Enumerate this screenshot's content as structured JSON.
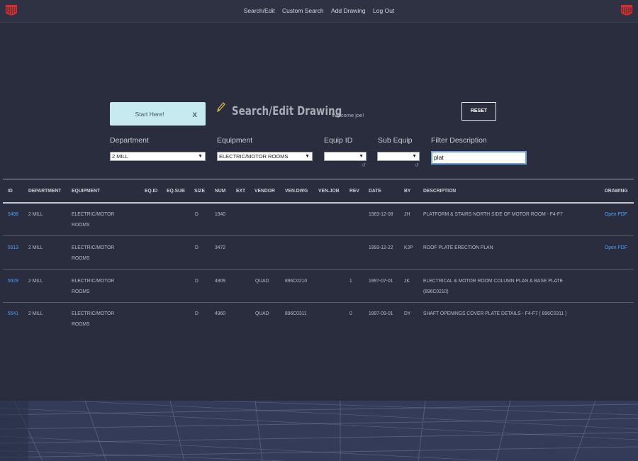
{
  "nav": {
    "items": [
      "Search/Edit",
      "Custom Search",
      "Add Drawing",
      "Log Out"
    ]
  },
  "colors": {
    "brand": "#e02b2b",
    "link": "#4aa1ff",
    "hint_bg": "#c7eaf0"
  },
  "hint": {
    "label": "Start Here!",
    "close": "x"
  },
  "page": {
    "title": "Search/Edit Drawing",
    "welcome": "Welcome joe!",
    "reset_label": "RESET"
  },
  "filters": {
    "department": {
      "label": "Department",
      "value": "2 MILL"
    },
    "equipment": {
      "label": "Equipment",
      "value": "ELECTRIC/MOTOR ROOMS"
    },
    "equip_id": {
      "label": "Equip ID",
      "value": ""
    },
    "sub_equip": {
      "label": "Sub Equip",
      "value": ""
    },
    "description": {
      "label": "Filter Description",
      "value": "plat"
    }
  },
  "table": {
    "headers": [
      "ID",
      "DEPARTMENT",
      "EQUIPMENT",
      "EQ.ID",
      "EQ.SUB",
      "SIZE",
      "NUM",
      "EXT",
      "VENDOR",
      "VEN.DWG",
      "VEN.JOB",
      "REV",
      "DATE",
      "BY",
      "DESCRIPTION",
      "DRAWING"
    ],
    "rows": [
      {
        "id": "5498",
        "department": "2 MILL",
        "equipment": "ELECTRIC/MOTOR ROOMS",
        "size": "D",
        "num": "1940",
        "vendor": "",
        "ven_dwg": "",
        "rev": "",
        "date": "1983-12-08",
        "by": "JH",
        "description": "PLATFORM & STAIRS NORTH SIDE OF MOTOR ROOM - F4-F7",
        "drawing": "Open PDF"
      },
      {
        "id": "5513",
        "department": "2 MILL",
        "equipment": "ELECTRIC/MOTOR ROOMS",
        "size": "D",
        "num": "3472",
        "vendor": "",
        "ven_dwg": "",
        "rev": "",
        "date": "1993-12-22",
        "by": "KJP",
        "description": "ROOF PLATE ERECTION PLAN",
        "drawing": "Open PDF"
      },
      {
        "id": "5529",
        "department": "2 MILL",
        "equipment": "ELECTRIC/MOTOR ROOMS",
        "size": "D",
        "num": "4909",
        "vendor": "QUAD",
        "ven_dwg": "896C0210",
        "rev": "1",
        "date": "1997-07-01",
        "by": "JK",
        "description": "ELECTRICAL & MOTOR ROOM COLUMN PLAN & BASE PLATE (896C0210)",
        "drawing": ""
      },
      {
        "id": "5541",
        "department": "2 MILL",
        "equipment": "ELECTRIC/MOTOR ROOMS",
        "size": "D",
        "num": "4960",
        "vendor": "QUAD",
        "ven_dwg": "896C0311",
        "rev": "0",
        "date": "1997-09-01",
        "by": "DY",
        "description": "SHAFT OPENINGS COVER PLATE DETAILS - F4-F7 ( 896C0311 )",
        "drawing": ""
      }
    ]
  }
}
